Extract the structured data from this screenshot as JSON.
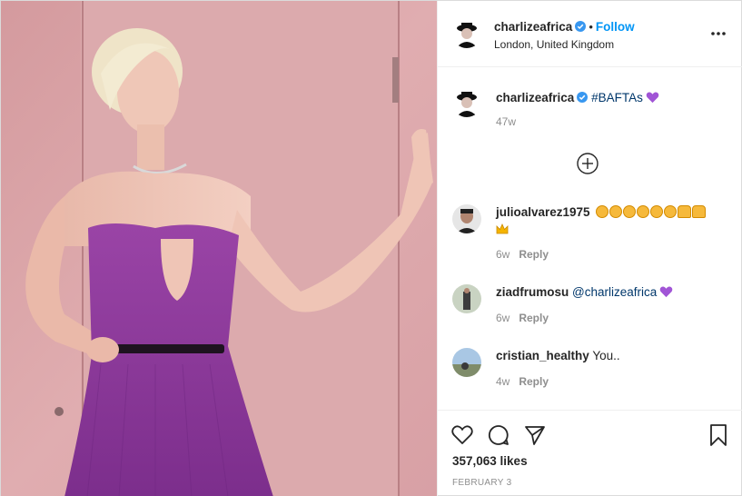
{
  "post": {
    "author": "charlizeafrica",
    "follow_label": "Follow",
    "separator": "•",
    "location": "London, United Kingdom",
    "more_label": "•••"
  },
  "caption": {
    "username": "charlizeafrica",
    "hashtag": "#BAFTAs",
    "age": "47w"
  },
  "comments": [
    {
      "username": "julioalvarez1975",
      "text": "",
      "age": "6w",
      "reply_label": "Reply"
    },
    {
      "username": "ziadfrumosu",
      "mention": "@charlizeafrica",
      "age": "6w",
      "reply_label": "Reply"
    },
    {
      "username": "cristian_healthy",
      "text": "You..",
      "age": "4w",
      "reply_label": "Reply"
    }
  ],
  "stats": {
    "likes": "357,063 likes",
    "date": "FEBRUARY 3"
  },
  "icons": {
    "more": "more-options-icon",
    "verified": "verified-badge-icon",
    "load_more": "plus-circle-icon",
    "like": "heart-outline-icon",
    "comment": "comment-bubble-icon",
    "share": "paper-plane-icon",
    "save": "bookmark-icon"
  },
  "colors": {
    "accent": "#0095f6",
    "link": "#00376b",
    "muted": "#8e8e8e",
    "dress": "#8e3a9a",
    "wall": "#d9a3a6"
  }
}
